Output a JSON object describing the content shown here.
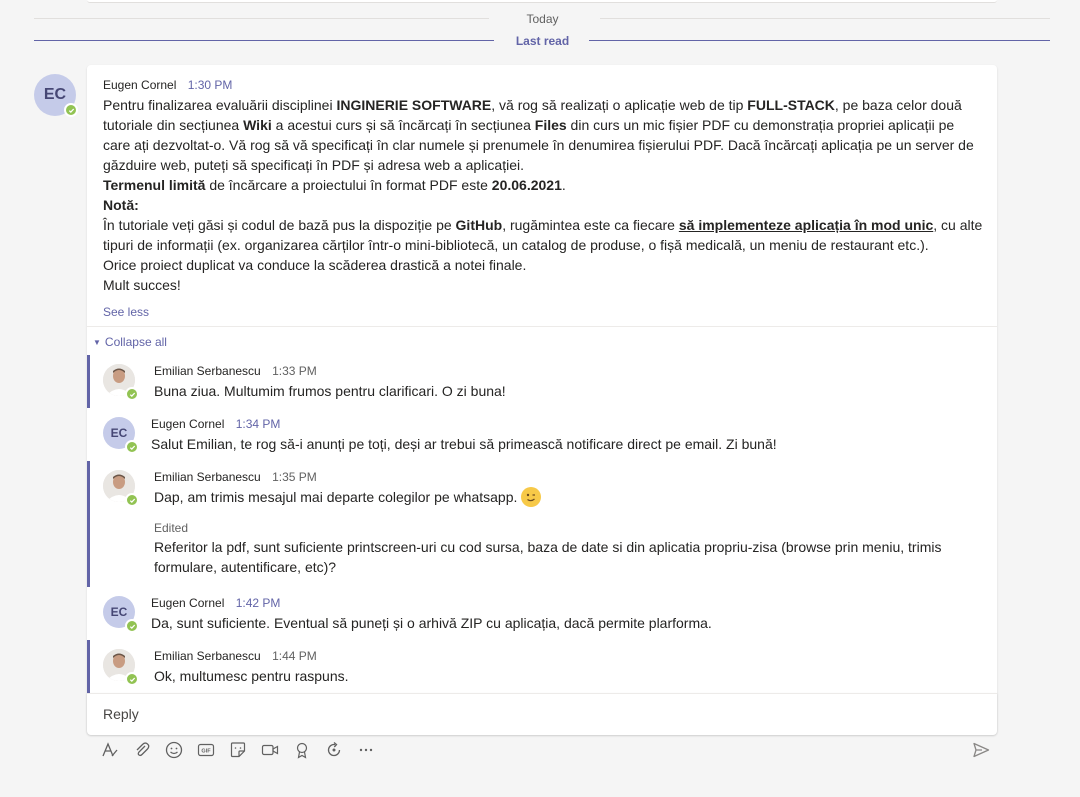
{
  "divider": {
    "today": "Today",
    "last_read": "Last read"
  },
  "root": {
    "author": "Eugen Cornel",
    "initials": "EC",
    "time": "1:30 PM",
    "see_less": "See less"
  },
  "collapse_all": "Collapse all",
  "replies": [
    {
      "author": "Emilian Serbanescu",
      "time": "1:33 PM",
      "text": "Buna ziua. Multumim frumos pentru clarificari. O zi buna!"
    },
    {
      "author": "Eugen Cornel",
      "initials": "EC",
      "time": "1:34 PM",
      "text": "Salut Emilian, te rog să-i anunți pe toți, deși ar trebui să primească notificare direct pe email. Zi bună!"
    },
    {
      "author": "Emilian Serbanescu",
      "time": "1:35 PM",
      "text": "Dap, am trimis mesajul mai departe colegilor pe whatsapp.",
      "edited_label": "Edited",
      "text2": "Referitor la pdf, sunt suficiente printscreen-uri cu cod sursa, baza de date si din aplicatia propriu-zisa (browse prin meniu, trimis formulare,  autentificare, etc)?"
    },
    {
      "author": "Eugen Cornel",
      "initials": "EC",
      "time": "1:42 PM",
      "text": "Da, sunt suficiente. Eventual să puneți și o arhivă ZIP cu aplicația, dacă permite plarforma."
    },
    {
      "author": "Emilian Serbanescu",
      "time": "1:44 PM",
      "text": "Ok, multumesc pentru raspuns."
    }
  ],
  "reply_box": {
    "placeholder": "Reply"
  },
  "toolbar": {
    "icons": [
      "format-icon",
      "attach-icon",
      "emoji-icon",
      "gif-icon",
      "sticker-icon",
      "meet-now-icon",
      "praise-icon",
      "loop-icon",
      "more-options-icon",
      "send-icon"
    ]
  },
  "colors": {
    "accent": "#6264a7",
    "presence": "#92c353",
    "avatar_bg": "#c5cbe9"
  }
}
